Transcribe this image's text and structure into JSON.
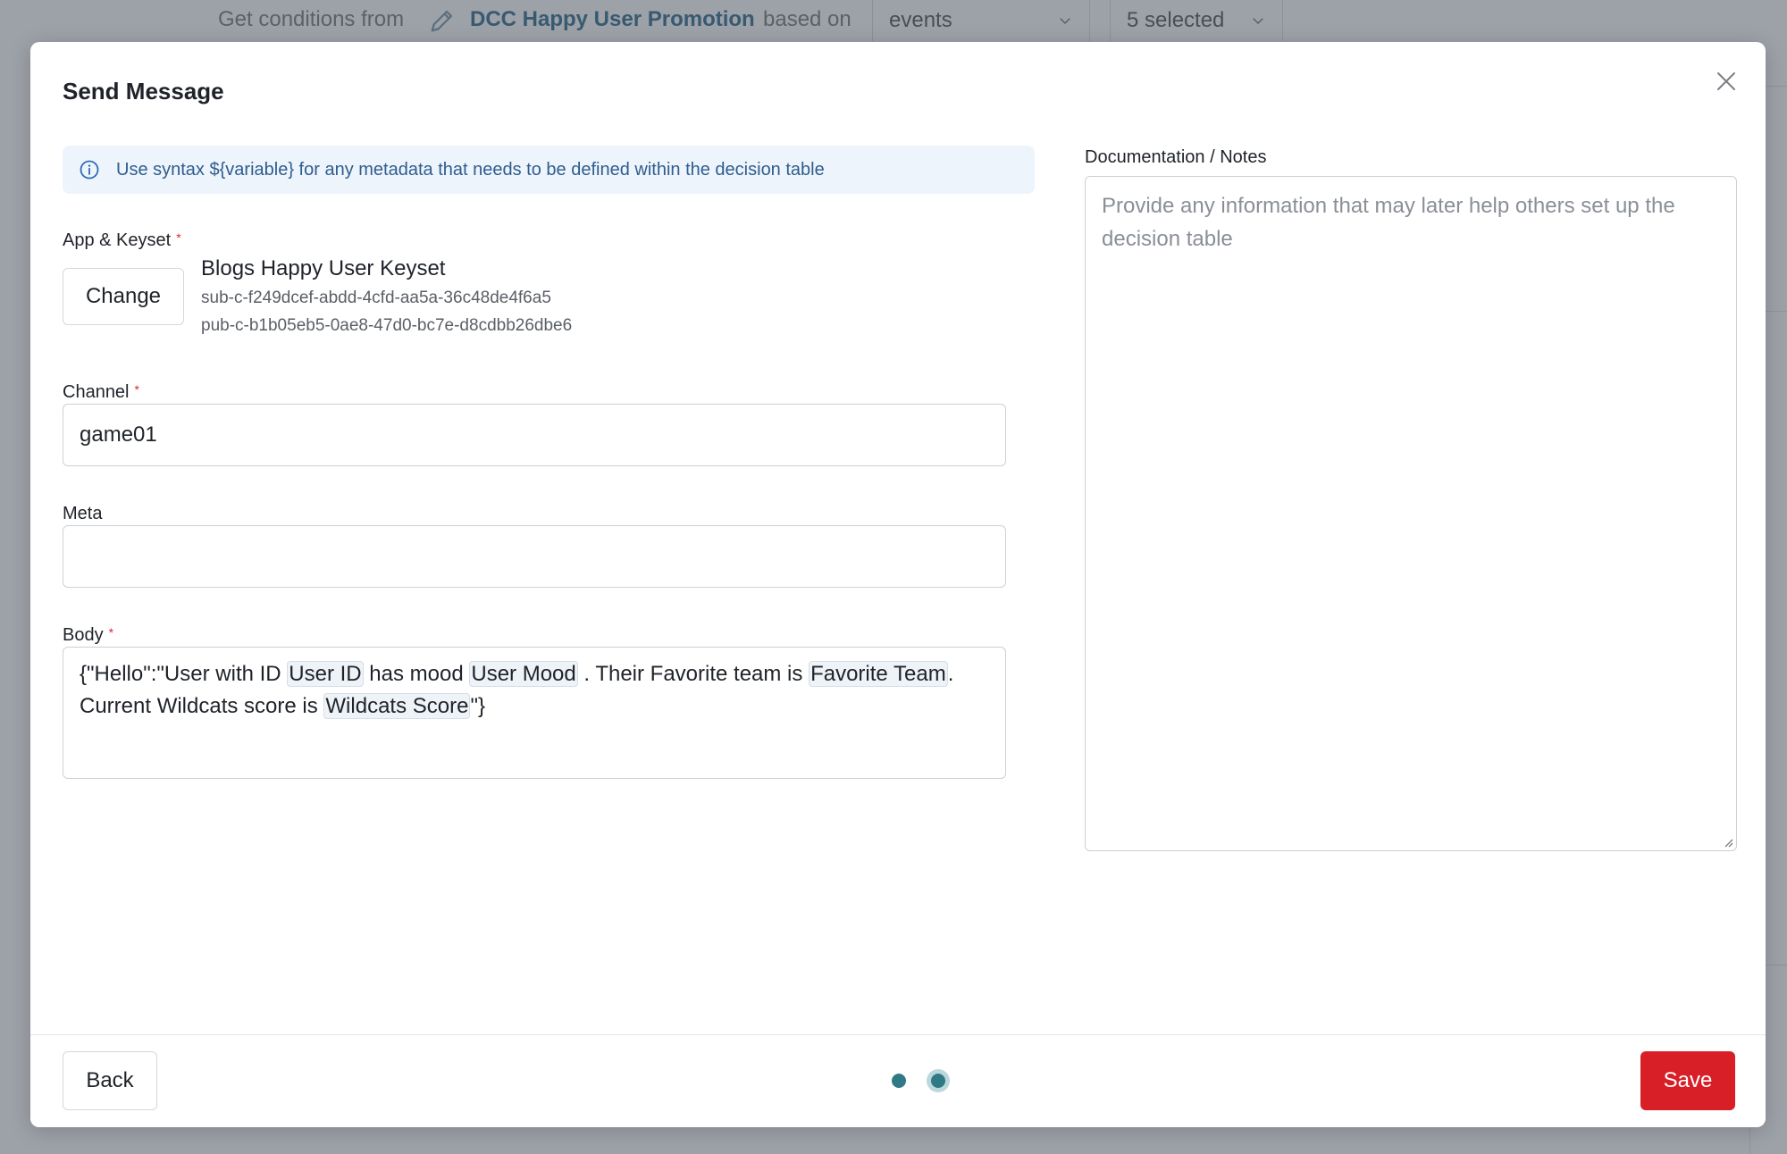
{
  "background": {
    "conditions_label": "Get conditions from",
    "source_name": "DCC Happy User Promotion",
    "based_on_label": "based on",
    "events_select": "events",
    "selected_select": "5 selected"
  },
  "modal": {
    "title": "Send Message",
    "info_text": "Use syntax ${variable} for any metadata that needs to be defined within the decision table",
    "app_keyset": {
      "label": "App & Keyset",
      "required_mark": "*",
      "change_label": "Change",
      "keyset_name": "Blogs Happy User Keyset",
      "subscribe_key": "sub-c-f249dcef-abdd-4cfd-aa5a-36c48de4f6a5",
      "publish_key": "pub-c-b1b05eb5-0ae8-47d0-bc7e-d8cdbb26dbe6"
    },
    "channel": {
      "label": "Channel",
      "required_mark": "*",
      "value": "game01"
    },
    "meta": {
      "label": "Meta",
      "value": ""
    },
    "body": {
      "label": "Body",
      "required_mark": "*",
      "text_1": "{\"Hello\":\"User with ID ",
      "chip_user_id": "User ID",
      "text_2": " has mood ",
      "chip_user_mood": "User Mood",
      "text_3": " .  Their Favorite team is ",
      "chip_favorite_team": "Favorite Team",
      "text_4": ". Current Wildcats score is ",
      "chip_wildcats_score": "Wildcats Score",
      "text_5": "\"}"
    },
    "notes": {
      "label": "Documentation / Notes",
      "placeholder": "Provide any information that may later help others set up the decision table",
      "value": ""
    },
    "footer": {
      "back_label": "Back",
      "save_label": "Save",
      "steps_total": 2,
      "current_step": 2
    }
  },
  "colors": {
    "save": "#d81f28",
    "info_bg": "#eef4fc",
    "info_text": "#2e5d8e",
    "step_dot": "#2f7a84",
    "overlay": "#9da1a8"
  },
  "icons": {
    "pencil": "pencil-icon",
    "chevron": "chevron-down-icon",
    "info": "info-icon",
    "close": "close-icon",
    "resize": "resize-grip-icon"
  }
}
